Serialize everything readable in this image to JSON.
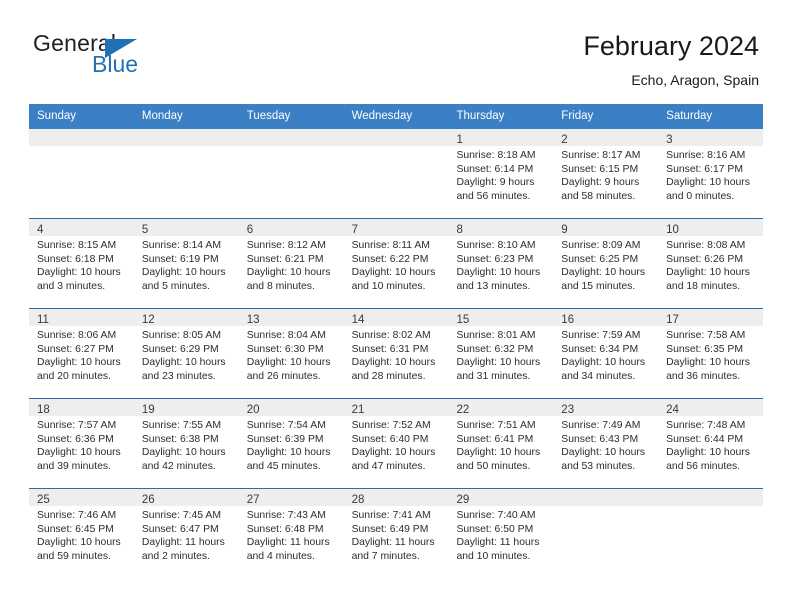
{
  "brand": {
    "name_top": "General",
    "name_bottom": "Blue",
    "triangle_color": "#1f72b5",
    "text_color": "#231f20"
  },
  "header": {
    "title": "February 2024",
    "subtitle": "Echo, Aragon, Spain"
  },
  "theme": {
    "header_bar": "#3b7fc4",
    "week_divider": "#2b6cad",
    "daynum_band": "#eeeeee",
    "page_background": "#ffffff",
    "text": "#2d2d2d"
  },
  "weekday_headers": [
    "Sunday",
    "Monday",
    "Tuesday",
    "Wednesday",
    "Thursday",
    "Friday",
    "Saturday"
  ],
  "weeks": [
    [
      {
        "day": "",
        "lines": []
      },
      {
        "day": "",
        "lines": []
      },
      {
        "day": "",
        "lines": []
      },
      {
        "day": "",
        "lines": []
      },
      {
        "day": "1",
        "lines": [
          "Sunrise: 8:18 AM",
          "Sunset: 6:14 PM",
          "Daylight: 9 hours",
          "and 56 minutes."
        ]
      },
      {
        "day": "2",
        "lines": [
          "Sunrise: 8:17 AM",
          "Sunset: 6:15 PM",
          "Daylight: 9 hours",
          "and 58 minutes."
        ]
      },
      {
        "day": "3",
        "lines": [
          "Sunrise: 8:16 AM",
          "Sunset: 6:17 PM",
          "Daylight: 10 hours",
          "and 0 minutes."
        ]
      }
    ],
    [
      {
        "day": "4",
        "lines": [
          "Sunrise: 8:15 AM",
          "Sunset: 6:18 PM",
          "Daylight: 10 hours",
          "and 3 minutes."
        ]
      },
      {
        "day": "5",
        "lines": [
          "Sunrise: 8:14 AM",
          "Sunset: 6:19 PM",
          "Daylight: 10 hours",
          "and 5 minutes."
        ]
      },
      {
        "day": "6",
        "lines": [
          "Sunrise: 8:12 AM",
          "Sunset: 6:21 PM",
          "Daylight: 10 hours",
          "and 8 minutes."
        ]
      },
      {
        "day": "7",
        "lines": [
          "Sunrise: 8:11 AM",
          "Sunset: 6:22 PM",
          "Daylight: 10 hours",
          "and 10 minutes."
        ]
      },
      {
        "day": "8",
        "lines": [
          "Sunrise: 8:10 AM",
          "Sunset: 6:23 PM",
          "Daylight: 10 hours",
          "and 13 minutes."
        ]
      },
      {
        "day": "9",
        "lines": [
          "Sunrise: 8:09 AM",
          "Sunset: 6:25 PM",
          "Daylight: 10 hours",
          "and 15 minutes."
        ]
      },
      {
        "day": "10",
        "lines": [
          "Sunrise: 8:08 AM",
          "Sunset: 6:26 PM",
          "Daylight: 10 hours",
          "and 18 minutes."
        ]
      }
    ],
    [
      {
        "day": "11",
        "lines": [
          "Sunrise: 8:06 AM",
          "Sunset: 6:27 PM",
          "Daylight: 10 hours",
          "and 20 minutes."
        ]
      },
      {
        "day": "12",
        "lines": [
          "Sunrise: 8:05 AM",
          "Sunset: 6:29 PM",
          "Daylight: 10 hours",
          "and 23 minutes."
        ]
      },
      {
        "day": "13",
        "lines": [
          "Sunrise: 8:04 AM",
          "Sunset: 6:30 PM",
          "Daylight: 10 hours",
          "and 26 minutes."
        ]
      },
      {
        "day": "14",
        "lines": [
          "Sunrise: 8:02 AM",
          "Sunset: 6:31 PM",
          "Daylight: 10 hours",
          "and 28 minutes."
        ]
      },
      {
        "day": "15",
        "lines": [
          "Sunrise: 8:01 AM",
          "Sunset: 6:32 PM",
          "Daylight: 10 hours",
          "and 31 minutes."
        ]
      },
      {
        "day": "16",
        "lines": [
          "Sunrise: 7:59 AM",
          "Sunset: 6:34 PM",
          "Daylight: 10 hours",
          "and 34 minutes."
        ]
      },
      {
        "day": "17",
        "lines": [
          "Sunrise: 7:58 AM",
          "Sunset: 6:35 PM",
          "Daylight: 10 hours",
          "and 36 minutes."
        ]
      }
    ],
    [
      {
        "day": "18",
        "lines": [
          "Sunrise: 7:57 AM",
          "Sunset: 6:36 PM",
          "Daylight: 10 hours",
          "and 39 minutes."
        ]
      },
      {
        "day": "19",
        "lines": [
          "Sunrise: 7:55 AM",
          "Sunset: 6:38 PM",
          "Daylight: 10 hours",
          "and 42 minutes."
        ]
      },
      {
        "day": "20",
        "lines": [
          "Sunrise: 7:54 AM",
          "Sunset: 6:39 PM",
          "Daylight: 10 hours",
          "and 45 minutes."
        ]
      },
      {
        "day": "21",
        "lines": [
          "Sunrise: 7:52 AM",
          "Sunset: 6:40 PM",
          "Daylight: 10 hours",
          "and 47 minutes."
        ]
      },
      {
        "day": "22",
        "lines": [
          "Sunrise: 7:51 AM",
          "Sunset: 6:41 PM",
          "Daylight: 10 hours",
          "and 50 minutes."
        ]
      },
      {
        "day": "23",
        "lines": [
          "Sunrise: 7:49 AM",
          "Sunset: 6:43 PM",
          "Daylight: 10 hours",
          "and 53 minutes."
        ]
      },
      {
        "day": "24",
        "lines": [
          "Sunrise: 7:48 AM",
          "Sunset: 6:44 PM",
          "Daylight: 10 hours",
          "and 56 minutes."
        ]
      }
    ],
    [
      {
        "day": "25",
        "lines": [
          "Sunrise: 7:46 AM",
          "Sunset: 6:45 PM",
          "Daylight: 10 hours",
          "and 59 minutes."
        ]
      },
      {
        "day": "26",
        "lines": [
          "Sunrise: 7:45 AM",
          "Sunset: 6:47 PM",
          "Daylight: 11 hours",
          "and 2 minutes."
        ]
      },
      {
        "day": "27",
        "lines": [
          "Sunrise: 7:43 AM",
          "Sunset: 6:48 PM",
          "Daylight: 11 hours",
          "and 4 minutes."
        ]
      },
      {
        "day": "28",
        "lines": [
          "Sunrise: 7:41 AM",
          "Sunset: 6:49 PM",
          "Daylight: 11 hours",
          "and 7 minutes."
        ]
      },
      {
        "day": "29",
        "lines": [
          "Sunrise: 7:40 AM",
          "Sunset: 6:50 PM",
          "Daylight: 11 hours",
          "and 10 minutes."
        ]
      },
      {
        "day": "",
        "lines": []
      },
      {
        "day": "",
        "lines": []
      }
    ]
  ]
}
